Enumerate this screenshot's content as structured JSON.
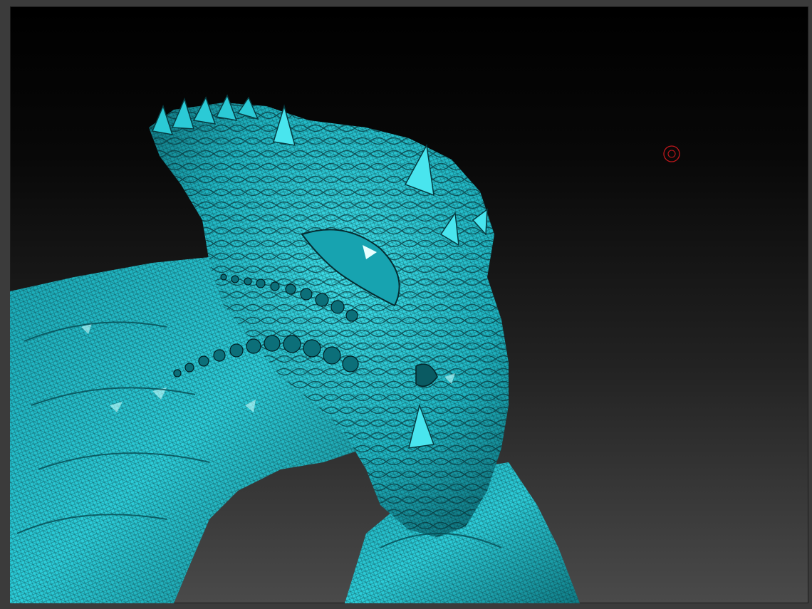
{
  "app": {
    "title": "",
    "background_color": "#3b3b3b"
  },
  "viewport": {
    "gradient_top": "#000000",
    "gradient_bottom": "#4a4a4a",
    "model": {
      "subject": "dragon-head-sculpt",
      "material_color": "#25c4d0",
      "wireframe_visible": true
    },
    "brush_cursor": {
      "icon": "brush-cursor-icon",
      "color": "#c0181c"
    }
  }
}
